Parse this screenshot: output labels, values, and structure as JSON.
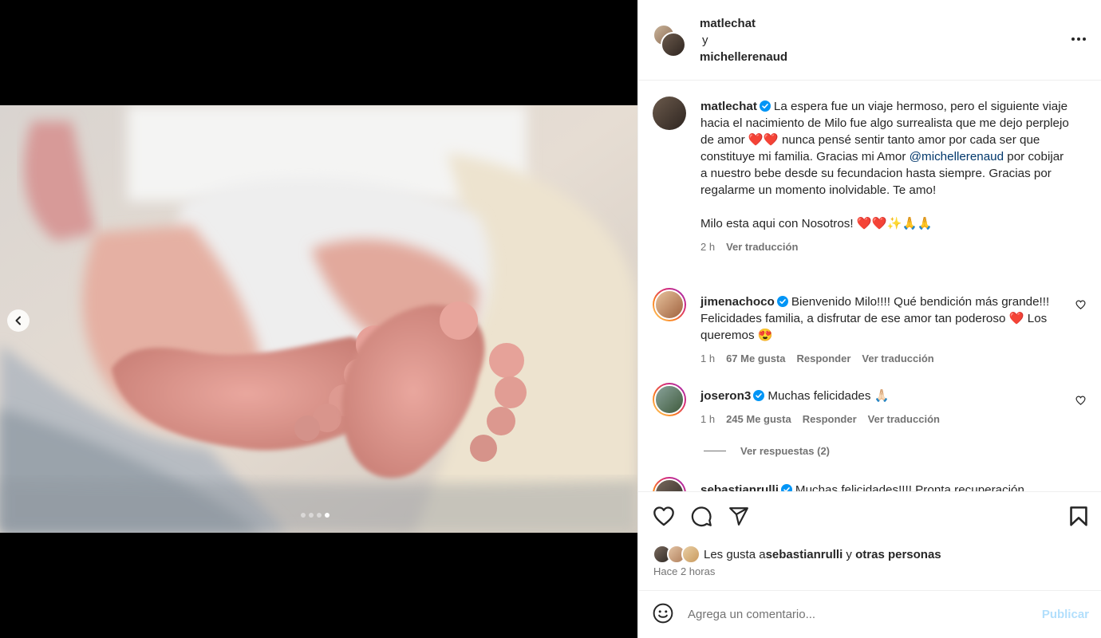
{
  "colors": {
    "accent": "#0095f6",
    "verified": "#0095f6",
    "text": "#262626",
    "muted": "#737373",
    "heart": "#ed4956"
  },
  "media": {
    "prev_icon": "chevron-left-icon",
    "dots_total": 4,
    "dots_active": 4
  },
  "header": {
    "user1": "matlechat",
    "connector": "y",
    "user2": "michellerenaud",
    "more_icon": "more-horizontal-icon"
  },
  "caption": {
    "username": "matlechat",
    "text_part1": "La espera fue un viaje hermoso, pero el siguiente viaje hacia el nacimiento de Milo fue algo surrealista que me dejo perplejo de amor ❤️❤️ nunca pensé sentir tanto amor por cada ser que constituye mi familia. Gracias mi Amor ",
    "mention": "@michellerenaud",
    "text_part2": " por cobijar a nuestro bebe desde su fecundacion hasta siempre. Gracias por regalarme un momento inolvidable. Te amo!",
    "text_line2": "Milo esta aqui con Nosotros! ❤️❤️✨🙏🙏",
    "time": "2 h",
    "translate": "Ver traducción"
  },
  "comments": [
    {
      "username": "jimenachoco",
      "text": "Bienvenido Milo!!!! Qué bendición más grande!!! Felicidades familia, a disfrutar de ese amor tan poderoso ❤️ Los queremos 😍",
      "time": "1 h",
      "likes": "67 Me gusta",
      "reply": "Responder",
      "translate": "Ver traducción"
    },
    {
      "username": "joseron3",
      "text": "Muchas felicidades 🙏🏻",
      "time": "1 h",
      "likes": "245 Me gusta",
      "reply": "Responder",
      "translate": "Ver traducción"
    },
    {
      "username": "sebastianrulli",
      "text": "Muchas felicidades!!!! Pronta recuperación"
    }
  ],
  "view_replies": "Ver respuestas (2)",
  "actions": {
    "like_icon": "heart-icon",
    "comment_icon": "comment-icon",
    "share_icon": "send-icon",
    "save_icon": "bookmark-icon"
  },
  "likes": {
    "prefix": "Les gusta a ",
    "user": "sebastianrulli",
    "middle": " y ",
    "others": "otras personas"
  },
  "posted": "Hace 2 horas",
  "add_comment": {
    "placeholder": "Agrega un comentario...",
    "publish": "Publicar",
    "emoji_icon": "emoji-icon"
  }
}
